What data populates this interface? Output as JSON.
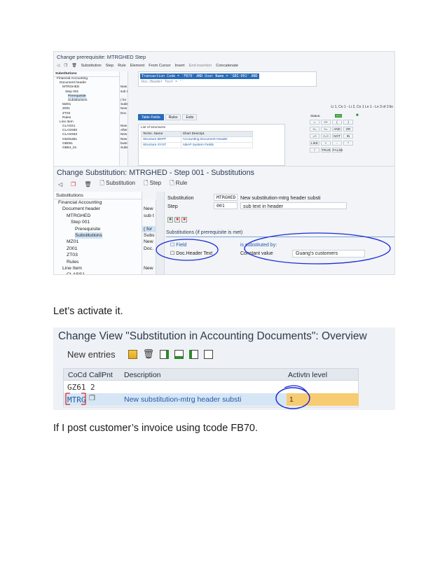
{
  "shot1": {
    "title": "Change prerequisite: MTRGHED Step",
    "toolbar": [
      "Substitution",
      "Step",
      "Rule",
      "Element",
      "From Cursor",
      "Insert",
      "End insertion",
      "Concatenate"
    ],
    "tree_header": "Substitutions",
    "tree": [
      {
        "label": "Financial Accounting",
        "indent": 1,
        "desc": ""
      },
      {
        "label": "Document header",
        "indent": 2,
        "desc": ""
      },
      {
        "label": "MTRGHED",
        "indent": 3,
        "desc": "New"
      },
      {
        "label": "Step 001",
        "indent": 4,
        "desc": "sub t"
      },
      {
        "label": "Prerequisite",
        "indent": 5,
        "desc": "",
        "selected": true
      },
      {
        "label": "Substitutions",
        "indent": 5,
        "desc": "( for"
      },
      {
        "label": "MZ01",
        "indent": 3,
        "desc": "Subs"
      },
      {
        "label": "Z001",
        "indent": 3,
        "desc": "New"
      },
      {
        "label": "ZT03",
        "indent": 3,
        "desc": "Doc."
      },
      {
        "label": "Rules",
        "indent": 3,
        "desc": ""
      },
      {
        "label": "Line Item",
        "indent": 2,
        "desc": ""
      },
      {
        "label": "CLASS1",
        "indent": 3,
        "desc": "New"
      },
      {
        "label": "CLASS60",
        "indent": 3,
        "desc": "After"
      },
      {
        "label": "CLASS63",
        "indent": 3,
        "desc": "New"
      },
      {
        "label": "G625UB1",
        "indent": 3,
        "desc": "New"
      },
      {
        "label": "GB051",
        "indent": 3,
        "desc": "busin"
      },
      {
        "label": "GB64_01",
        "indent": 3,
        "desc": "Subst"
      }
    ],
    "code_line1": "Transaction Code = 'FB70' AND User Name = 'GBI-001' AND",
    "code_line2": "Doc.Header Text = ''",
    "coords": "Li 1, Co 1 - Li 2, Co 1  Ln 1 - Ln 3 of 3 lin",
    "tabs": [
      "Table Fields",
      "Rules",
      "Exits"
    ],
    "struct_caption": "List of structures",
    "struct_headers": [
      "Techn. Name",
      "Short Descript."
    ],
    "struct_rows": [
      [
        "Structure BKPF",
        "Accounting Document Header"
      ],
      [
        "Structure SYST",
        "ABAP System Fields"
      ]
    ],
    "status_label": "Status:",
    "ops": [
      "=",
      "<>",
      "(",
      ")",
      "<=",
      ">=",
      "AND",
      "OR",
      "=>",
      "<=>",
      "NOT",
      "IN",
      "LIKE",
      "+",
      "-",
      "*",
      "/",
      "TRUE",
      "FALSE"
    ]
  },
  "shot2": {
    "title": "Change Substitution: MTRGHED - Step 001 - Substitutions",
    "toolbar": [
      "Substitution",
      "Step",
      "Rule"
    ],
    "tree_header": "Substitutions",
    "tree": [
      {
        "label": "Financial Accounting",
        "indent": 1
      },
      {
        "label": "Document header",
        "indent": 2
      },
      {
        "label": "MTRGHED",
        "indent": 3
      },
      {
        "label": "Step 001",
        "indent": 4
      },
      {
        "label": "Prerequisite",
        "indent": 5
      },
      {
        "label": "Substitutions",
        "indent": 5,
        "selected": true
      },
      {
        "label": "MZ01",
        "indent": 3
      },
      {
        "label": "Z001",
        "indent": 3
      },
      {
        "label": "ZT03",
        "indent": 3
      },
      {
        "label": "Rules",
        "indent": 3
      },
      {
        "label": "Line Item",
        "indent": 2
      },
      {
        "label": "CLASS1",
        "indent": 3
      }
    ],
    "desc_col": [
      "",
      "New",
      "sub t",
      "",
      "( for",
      "Subs",
      "New",
      "Doc.",
      "",
      "",
      "New"
    ],
    "substitution_label": "Substitution",
    "substitution_value": "MTRGHED",
    "substitution_text": "New substitution-mtrg header substi",
    "step_label": "Step",
    "step_value": "001",
    "step_text": "sub text in header",
    "section_title": "Substitutions (if prerequisite is met)",
    "field_header": "Field",
    "field_value": "Doc.Header Text",
    "subst_by_header": "is substituted by:",
    "constant_label": "Constant value",
    "constant_value": "Guang's customers"
  },
  "text1": "Let’s activate it.",
  "shot3": {
    "title": "Change View \"Substitution in Accounting Documents\": Overview",
    "new_entries": "New entries",
    "headers": [
      "CoCd",
      "CallPnt",
      "Description",
      "Activtn level"
    ],
    "row1": {
      "cocd": "GZ61",
      "callpnt": "2"
    },
    "row2": {
      "cocd": "MTRG",
      "desc": "New substitution-mtrg header substi",
      "level": "1"
    }
  },
  "text2": "If I post customer’s invoice using tcode FB70.",
  "colors": {
    "sap_blue": "#2a6bb8",
    "annotation": "#1a2bd6",
    "highlight": "#f7cb72"
  }
}
